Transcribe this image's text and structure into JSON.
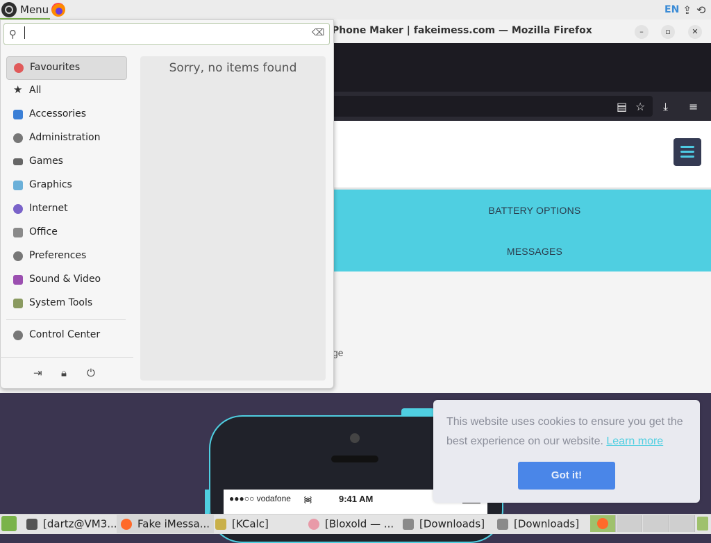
{
  "top_panel": {
    "menu_label": "Menu",
    "language": "EN",
    "tray": [
      "update-icon",
      "network-icon"
    ]
  },
  "firefox": {
    "title": "Phone Maker | fakeimess.com — Mozilla Firefox",
    "window_buttons": [
      "minimize-icon",
      "maximize-icon",
      "close-icon"
    ],
    "toolbar_icons": [
      "reader-view-icon",
      "bookmark-star-icon",
      "download-icon",
      "hamburger-menu-icon"
    ]
  },
  "website": {
    "nav_items": [
      "BATTERY OPTIONS",
      "MESSAGES"
    ],
    "body_fragment": "ge",
    "phone": {
      "carrier_status": "●●●○○ vodafone",
      "time": "9:41 AM"
    },
    "cookie_banner": {
      "message": "This website uses cookies to ensure you get the best experience on our website.",
      "link": "Learn more",
      "button": "Got it!"
    }
  },
  "menu": {
    "search": {
      "value": "",
      "placeholder": ""
    },
    "categories": [
      {
        "label": "Favourites",
        "icon": "heart-icon",
        "color": "#e05a5a"
      },
      {
        "label": "All",
        "icon": "star-icon",
        "color": "#333333"
      },
      {
        "label": "Accessories",
        "icon": "accessories-icon",
        "color": "#3b7fd6"
      },
      {
        "label": "Administration",
        "icon": "administration-icon",
        "color": "#777777"
      },
      {
        "label": "Games",
        "icon": "games-icon",
        "color": "#666666"
      },
      {
        "label": "Graphics",
        "icon": "graphics-icon",
        "color": "#6bb0d9"
      },
      {
        "label": "Internet",
        "icon": "internet-icon",
        "color": "#7a63c9"
      },
      {
        "label": "Office",
        "icon": "office-icon",
        "color": "#8a8a8a"
      },
      {
        "label": "Preferences",
        "icon": "preferences-icon",
        "color": "#777777"
      },
      {
        "label": "Sound & Video",
        "icon": "sound-video-icon",
        "color": "#9b4fb0"
      },
      {
        "label": "System Tools",
        "icon": "system-tools-icon",
        "color": "#8a9a60"
      }
    ],
    "control_center": {
      "label": "Control Center",
      "icon": "control-center-icon"
    },
    "session_icons": [
      "logout-icon",
      "lock-icon",
      "power-icon"
    ],
    "empty_message": "Sorry, no items found"
  },
  "taskbar": {
    "items": [
      {
        "label": "[dartz@VM3...",
        "icon": "terminal-icon",
        "color": "#555555"
      },
      {
        "label": "Fake iMessa...",
        "icon": "firefox-icon",
        "color": "#ff6a2a"
      },
      {
        "label": "[KCalc]",
        "icon": "kcalc-icon",
        "color": "#c9b04a"
      },
      {
        "label": "[Bloxold — ...",
        "icon": "bloxold-icon",
        "color": "#e89aa8"
      },
      {
        "label": "[Downloads]",
        "icon": "folder-icon",
        "color": "#8a8a8a"
      },
      {
        "label": "[Downloads]",
        "icon": "folder-icon",
        "color": "#8a8a8a"
      }
    ],
    "trash_icon": "trash-icon"
  }
}
